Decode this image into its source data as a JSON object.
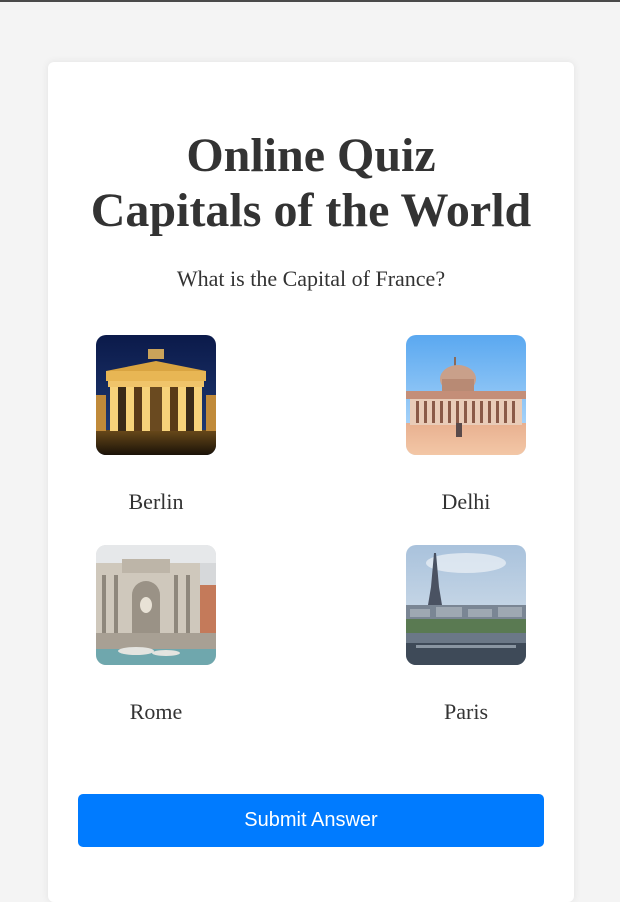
{
  "quiz": {
    "title_line1": "Online Quiz",
    "title_line2": "Capitals of the World",
    "question": "What is the Capital of France?",
    "options": [
      {
        "label": "Berlin",
        "image": "brandenburg-gate-image"
      },
      {
        "label": "Delhi",
        "image": "rashtrapati-bhavan-image"
      },
      {
        "label": "Rome",
        "image": "trevi-fountain-image"
      },
      {
        "label": "Paris",
        "image": "eiffel-tower-image"
      }
    ],
    "submit_label": "Submit Answer"
  },
  "colors": {
    "background": "#f4f4f4",
    "card": "#ffffff",
    "text": "#333333",
    "button": "#007bff",
    "button_text": "#ffffff"
  }
}
